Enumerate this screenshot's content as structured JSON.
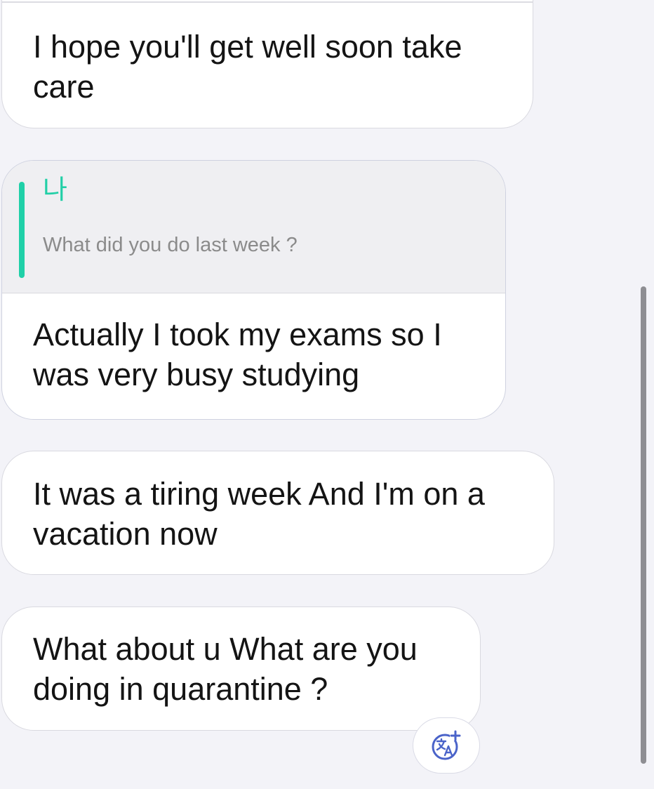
{
  "messages": [
    {
      "text": "I hope you'll get well soon take care"
    },
    {
      "reply": {
        "author": "나",
        "quoted_text": "What did you do last week ?"
      },
      "text": "Actually I took my exams so I was very busy studying"
    },
    {
      "text": "It was a tiring week And I'm on a vacation now"
    },
    {
      "text": "What about u What are you doing in quarantine ?"
    }
  ],
  "translate_button": {
    "icon": "translate-icon"
  },
  "colors": {
    "background": "#f3f3f8",
    "bubble": "#ffffff",
    "quote_accent": "#1fd0a8",
    "translate_icon": "#4a63c9"
  }
}
